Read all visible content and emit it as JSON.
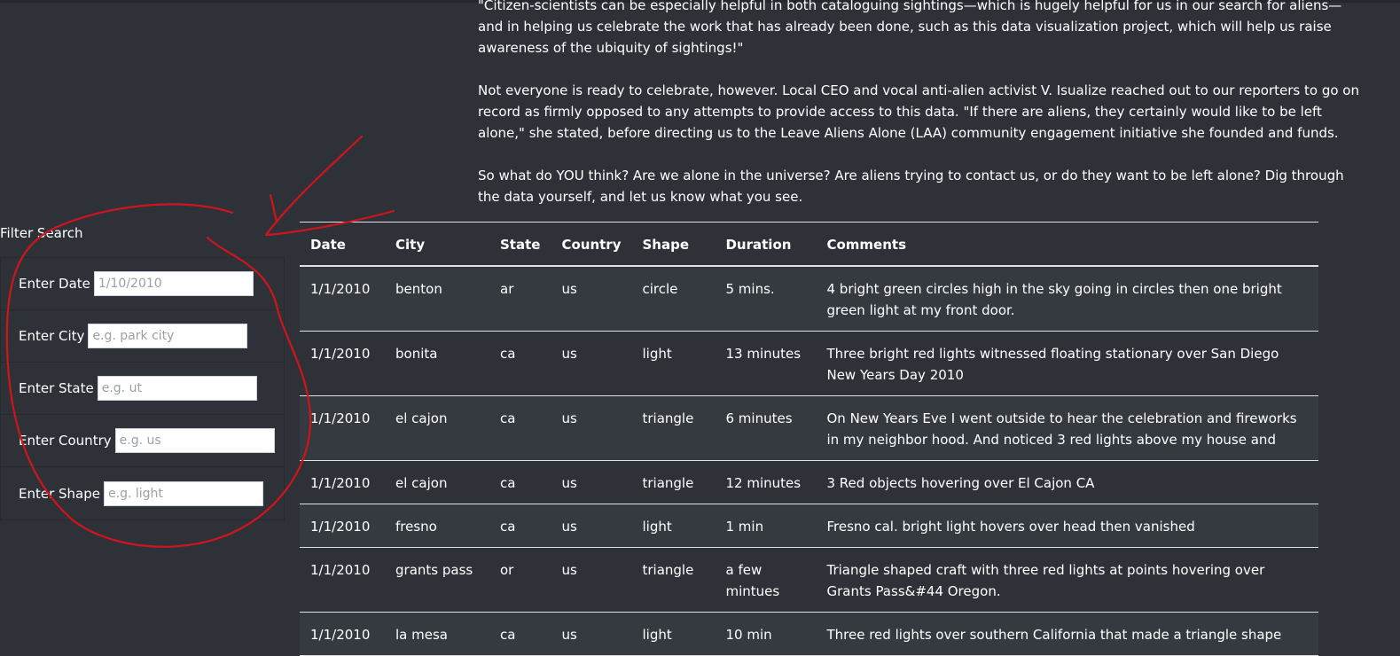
{
  "article": {
    "paragraphs": [
      "\"Citizen-scientists can be especially helpful in both cataloguing sightings—which is hugely helpful for us in our search for aliens—and in helping us celebrate the work that has already been done, such as this data visualization project, which will help us raise awareness of the ubiquity of sightings!\"",
      "Not everyone is ready to celebrate, however. Local CEO and vocal anti-alien activist V. Isualize reached out to our reporters to go on record as firmly opposed to any attempts to provide access to this data. \"If there are aliens, they certainly would like to be left alone,\" she stated, before directing us to the Leave Aliens Alone (LAA) community engagement initiative she founded and funds.",
      "So what do YOU think? Are we alone in the universe? Are aliens trying to contact us, or do they want to be left alone? Dig through the data yourself, and let us know what you see."
    ]
  },
  "filter": {
    "title": "Filter Search",
    "date": {
      "label": "Enter Date",
      "value": "",
      "placeholder": "1/10/2010"
    },
    "city": {
      "label": "Enter City",
      "value": "",
      "placeholder": "e.g. park city"
    },
    "state": {
      "label": "Enter State",
      "value": "",
      "placeholder": "e.g. ut"
    },
    "country": {
      "label": "Enter Country",
      "value": "",
      "placeholder": "e.g. us"
    },
    "shape": {
      "label": "Enter Shape",
      "value": "",
      "placeholder": "e.g. light"
    }
  },
  "table": {
    "headers": [
      "Date",
      "City",
      "State",
      "Country",
      "Shape",
      "Duration",
      "Comments"
    ],
    "rows": [
      [
        "1/1/2010",
        "benton",
        "ar",
        "us",
        "circle",
        "5 mins.",
        "4 bright green circles high in the sky going in circles then one bright green light at my front door."
      ],
      [
        "1/1/2010",
        "bonita",
        "ca",
        "us",
        "light",
        "13 minutes",
        "Three bright red lights witnessed floating stationary over San Diego New Years Day 2010"
      ],
      [
        "1/1/2010",
        "el cajon",
        "ca",
        "us",
        "triangle",
        "6 minutes",
        "On New Years Eve I went outside to hear the celebration and fireworks in my neighbor hood. And noticed 3 red lights above my house and"
      ],
      [
        "1/1/2010",
        "el cajon",
        "ca",
        "us",
        "triangle",
        "12 minutes",
        "3 Red objects hovering over El Cajon CA"
      ],
      [
        "1/1/2010",
        "fresno",
        "ca",
        "us",
        "light",
        "1 min",
        "Fresno cal. bright light hovers over head then vanished"
      ],
      [
        "1/1/2010",
        "grants pass",
        "or",
        "us",
        "triangle",
        "a few mintues",
        "Triangle shaped craft with three red lights at points hovering over Grants Pass&#44 Oregon."
      ],
      [
        "1/1/2010",
        "la mesa",
        "ca",
        "us",
        "light",
        "10 min",
        "Three red lights over southern California that made a triangle shape"
      ]
    ]
  },
  "colors": {
    "background": "#2e3238",
    "stripe": "#353a40",
    "annotation": "#d0141c"
  }
}
